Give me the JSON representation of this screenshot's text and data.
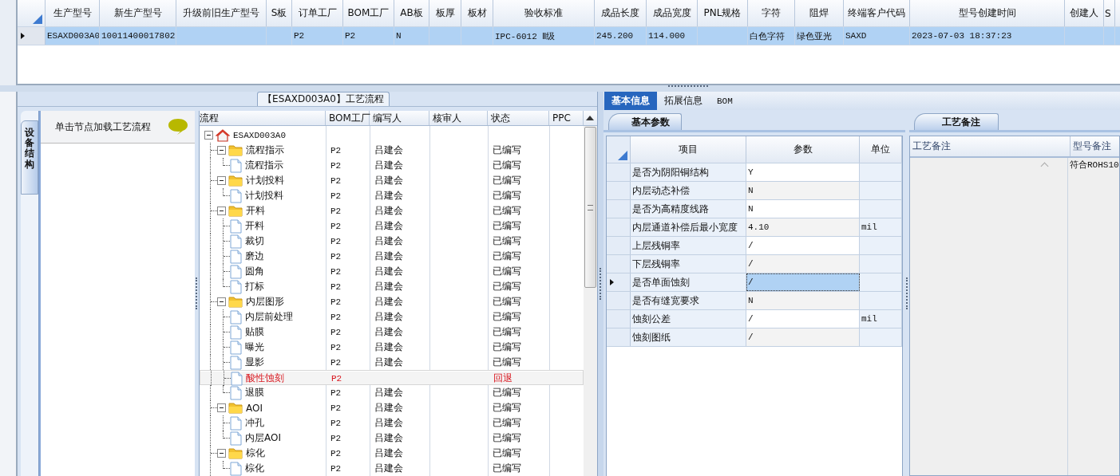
{
  "product_grid": {
    "columns": [
      "生产型号",
      "新生产型号",
      "升级前旧生产型号",
      "S板",
      "订单工厂",
      "BOM工厂",
      "AB板",
      "板厚",
      "板材",
      "验收标准",
      "成品长度",
      "成品宽度",
      "PNL规格",
      "字符",
      "阻焊",
      "终端客户代码",
      "型号创建时间",
      "创建人",
      "S"
    ],
    "rows": [
      {
        "selected": true,
        "cells": [
          "ESAXD003A0",
          "10011400017802",
          null,
          null,
          "P2",
          "P2",
          "N",
          null,
          null,
          "IPC-6012 Ⅱ级",
          "245.200",
          "114.000",
          null,
          "白色字符",
          "绿色亚光",
          "SAXD",
          "2023-07-03 18:37:23",
          null,
          null
        ]
      }
    ]
  },
  "flow": {
    "tab_title": "【ESAXD003A0】工艺流程",
    "side_tab": "设备结构",
    "hint": "单击节点加载工艺流程",
    "columns": [
      "流程",
      "BOM工厂",
      "编写人",
      "核审人",
      "状态",
      "PPC"
    ],
    "tree": {
      "name": "ESAXD003A0",
      "kind": "home",
      "expanded": true,
      "selected": false,
      "flagged": false,
      "children": [
        {
          "name": "流程指示",
          "kind": "folder",
          "expanded": true,
          "selected": false,
          "flagged": false,
          "bom_factory": "P2",
          "writer": "吕建会",
          "status": "已编写",
          "children": [
            {
              "name": "流程指示",
              "kind": "file",
              "selected": false,
              "flagged": false,
              "bom_factory": "P2",
              "writer": "吕建会",
              "status": "已编写"
            }
          ]
        },
        {
          "name": "计划投料",
          "kind": "folder",
          "expanded": true,
          "selected": false,
          "flagged": false,
          "bom_factory": "P2",
          "writer": "吕建会",
          "status": "已编写",
          "children": [
            {
              "name": "计划投料",
              "kind": "file",
              "selected": false,
              "flagged": false,
              "bom_factory": "P2",
              "writer": "吕建会",
              "status": "已编写"
            }
          ]
        },
        {
          "name": "开料",
          "kind": "folder",
          "expanded": true,
          "selected": false,
          "flagged": false,
          "bom_factory": "P2",
          "writer": "吕建会",
          "status": "已编写",
          "children": [
            {
              "name": "开料",
              "kind": "file",
              "selected": false,
              "flagged": false,
              "bom_factory": "P2",
              "writer": "吕建会",
              "status": "已编写"
            },
            {
              "name": "裁切",
              "kind": "file",
              "selected": false,
              "flagged": false,
              "bom_factory": "P2",
              "writer": "吕建会",
              "status": "已编写"
            },
            {
              "name": "磨边",
              "kind": "file",
              "selected": false,
              "flagged": false,
              "bom_factory": "P2",
              "writer": "吕建会",
              "status": "已编写"
            },
            {
              "name": "圆角",
              "kind": "file",
              "selected": false,
              "flagged": false,
              "bom_factory": "P2",
              "writer": "吕建会",
              "status": "已编写"
            },
            {
              "name": "打标",
              "kind": "file",
              "selected": false,
              "flagged": false,
              "bom_factory": "P2",
              "writer": "吕建会",
              "status": "已编写"
            }
          ]
        },
        {
          "name": "内层图形",
          "kind": "folder",
          "expanded": true,
          "selected": false,
          "flagged": false,
          "bom_factory": "P2",
          "writer": "吕建会",
          "status": "已编写",
          "children": [
            {
              "name": "内层前处理",
              "kind": "file",
              "selected": false,
              "flagged": false,
              "bom_factory": "P2",
              "writer": "吕建会",
              "status": "已编写"
            },
            {
              "name": "贴膜",
              "kind": "file",
              "selected": false,
              "flagged": false,
              "bom_factory": "P2",
              "writer": "吕建会",
              "status": "已编写"
            },
            {
              "name": "曝光",
              "kind": "file",
              "selected": false,
              "flagged": false,
              "bom_factory": "P2",
              "writer": "吕建会",
              "status": "已编写"
            },
            {
              "name": "显影",
              "kind": "file",
              "selected": false,
              "flagged": false,
              "bom_factory": "P2",
              "writer": "吕建会",
              "status": "已编写"
            },
            {
              "name": "酸性蚀刻",
              "kind": "file",
              "selected": true,
              "flagged": true,
              "bom_factory": "P2",
              "status": "回退"
            },
            {
              "name": "退膜",
              "kind": "file",
              "selected": false,
              "flagged": false,
              "bom_factory": "P2",
              "writer": "吕建会",
              "status": "已编写"
            }
          ]
        },
        {
          "name": "AOI",
          "kind": "folder",
          "expanded": true,
          "selected": false,
          "flagged": false,
          "bom_factory": "P2",
          "writer": "吕建会",
          "status": "已编写",
          "children": [
            {
              "name": "冲孔",
              "kind": "file",
              "selected": false,
              "flagged": false,
              "bom_factory": "P2",
              "writer": "吕建会",
              "status": "已编写"
            },
            {
              "name": "内层AOI",
              "kind": "file",
              "selected": false,
              "flagged": false,
              "bom_factory": "P2",
              "writer": "吕建会",
              "status": "已编写"
            }
          ]
        },
        {
          "name": "棕化",
          "kind": "folder",
          "expanded": true,
          "selected": false,
          "flagged": false,
          "bom_factory": "P2",
          "writer": "吕建会",
          "status": "已编写",
          "children": [
            {
              "name": "棕化",
              "kind": "file",
              "selected": false,
              "flagged": false,
              "bom_factory": "P2",
              "writer": "吕建会",
              "status": "已编写"
            }
          ]
        }
      ]
    }
  },
  "info": {
    "tabs": [
      {
        "label": "基本信息",
        "selected": true
      },
      {
        "label": "拓展信息",
        "selected": false
      },
      {
        "label": "BOM",
        "selected": false
      }
    ],
    "params": {
      "tab": "基本参数",
      "columns": [
        "项目",
        "参数",
        "单位"
      ],
      "rows": [
        {
          "item": "是否为阴阳铜结构",
          "value": "Y",
          "selected": false
        },
        {
          "item": "内层动态补偿",
          "value": "N",
          "selected": false
        },
        {
          "item": "是否为高精度线路",
          "value": "N",
          "selected": false
        },
        {
          "item": "内层通道补偿后最小宽度",
          "value": "4.10",
          "unit": "mil",
          "selected": false
        },
        {
          "item": "上层残铜率",
          "value": "/",
          "selected": false
        },
        {
          "item": "下层残铜率",
          "value": "/",
          "selected": false
        },
        {
          "item": "是否单面蚀刻",
          "value": "/",
          "selected": true
        },
        {
          "item": "是否有缝宽要求",
          "value": "N",
          "selected": false
        },
        {
          "item": "蚀刻公差",
          "value": "/",
          "unit": "mil",
          "selected": false
        },
        {
          "item": "蚀刻图纸",
          "value": "/",
          "selected": false
        }
      ]
    },
    "remarks": {
      "tab": "工艺备注",
      "columns": [
        "工艺备注",
        "型号备注"
      ],
      "model_remark": "符合ROHS10"
    }
  }
}
